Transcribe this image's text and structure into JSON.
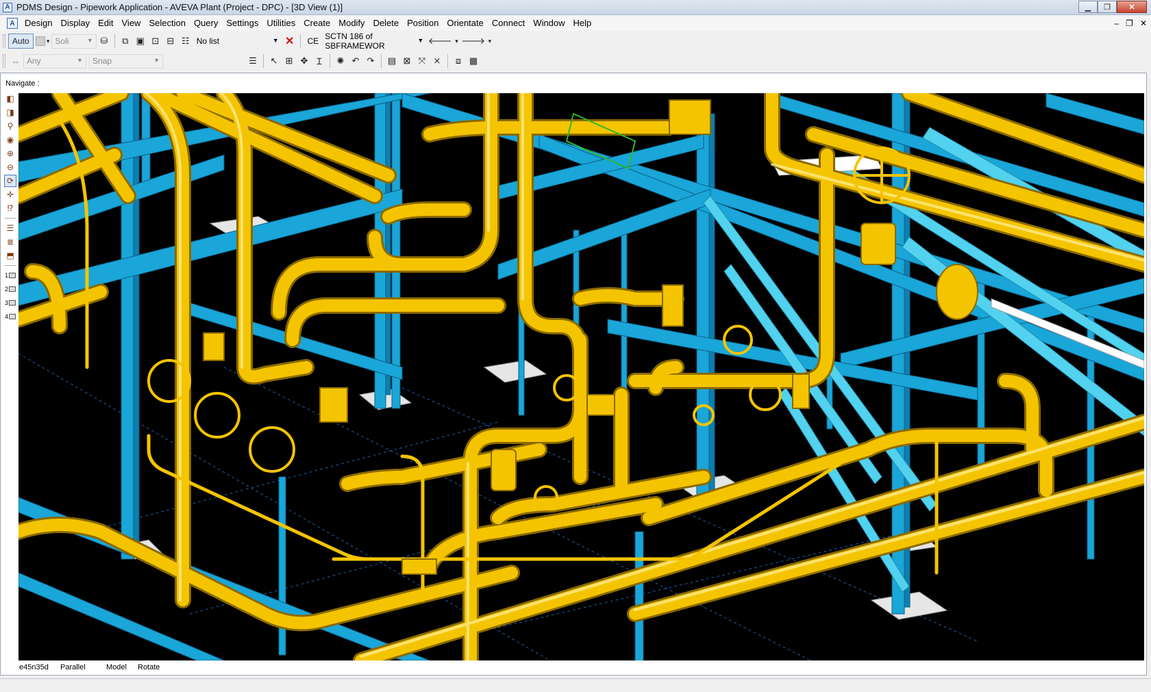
{
  "window": {
    "title": "PDMS Design - Pipework Application -  AVEVA Plant (Project - DPC) - [3D View (1)]",
    "min_label": "▁",
    "max_label": "❐",
    "close_label": "✕"
  },
  "menubar": {
    "items": [
      "Design",
      "Display",
      "Edit",
      "View",
      "Selection",
      "Query",
      "Settings",
      "Utilities",
      "Create",
      "Modify",
      "Delete",
      "Position",
      "Orientate",
      "Connect",
      "Window",
      "Help"
    ],
    "mdi_min": "–",
    "mdi_restore": "❐",
    "mdi_close": "✕"
  },
  "toolbar1": {
    "auto_label": "Auto",
    "solid_label": "Soli",
    "list_value": "No list",
    "ce_label": "CE",
    "ce_value": "SCTN 186 of SBFRAMEWOR"
  },
  "toolbar2": {
    "filter_value": "Any",
    "snap_value": "Snap"
  },
  "navigate_label": "Navigate :",
  "status": {
    "direction": "e45n35d",
    "projection": "Parallel",
    "mode": "Model",
    "action": "Rotate"
  },
  "sidebar": {
    "view_numbers": [
      "1",
      "2",
      "3",
      "4"
    ]
  },
  "colors": {
    "pipe": "#f5c400",
    "steel": "#1aa6d8",
    "steel_light": "#52d2ee",
    "background": "#000000",
    "foundation": "#e6e6e6"
  }
}
